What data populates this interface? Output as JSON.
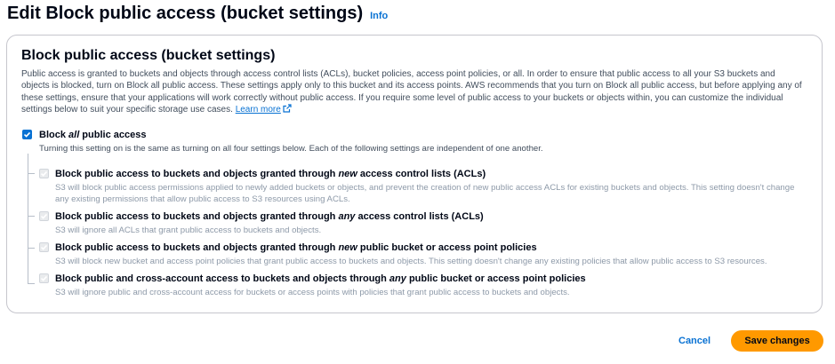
{
  "header": {
    "title": "Edit Block public access (bucket settings)",
    "info_link": "Info"
  },
  "panel": {
    "title": "Block public access (bucket settings)",
    "description": "Public access is granted to buckets and objects through access control lists (ACLs), bucket policies, access point policies, or all. In order to ensure that public access to all your S3 buckets and objects is blocked, turn on Block all public access. These settings apply only to this bucket and its access points. AWS recommends that you turn on Block all public access, but before applying any of these settings, ensure that your applications will work correctly without public access. If you require some level of public access to your buckets or objects within, you can customize the individual settings below to suit your specific storage use cases.",
    "learn_more": "Learn more",
    "block_all": {
      "label_pre": "Block ",
      "label_em": "all",
      "label_post": " public access",
      "description": "Turning this setting on is the same as turning on all four settings below. Each of the following settings are independent of one another.",
      "checked": true
    },
    "settings": [
      {
        "label_pre": "Block public access to buckets and objects granted through ",
        "label_em": "new",
        "label_post": " access control lists (ACLs)",
        "description": "S3 will block public access permissions applied to newly added buckets or objects, and prevent the creation of new public access ACLs for existing buckets and objects. This setting doesn't change any existing permissions that allow public access to S3 resources using ACLs.",
        "checked": true
      },
      {
        "label_pre": "Block public access to buckets and objects granted through ",
        "label_em": "any",
        "label_post": " access control lists (ACLs)",
        "description": "S3 will ignore all ACLs that grant public access to buckets and objects.",
        "checked": true
      },
      {
        "label_pre": "Block public access to buckets and objects granted through ",
        "label_em": "new",
        "label_post": " public bucket or access point policies",
        "description": "S3 will block new bucket and access point policies that grant public access to buckets and objects. This setting doesn't change any existing policies that allow public access to S3 resources.",
        "checked": true
      },
      {
        "label_pre": "Block public and cross-account access to buckets and objects through ",
        "label_em": "any",
        "label_post": " public bucket or access point policies",
        "description": "S3 will ignore public and cross-account access for buckets or access points with policies that grant public access to buckets and objects.",
        "checked": true
      }
    ]
  },
  "footer": {
    "cancel_label": "Cancel",
    "save_label": "Save changes"
  },
  "colors": {
    "accent": "#0972d3",
    "primary_button": "#ff9900",
    "border": "#c6c6cd"
  }
}
